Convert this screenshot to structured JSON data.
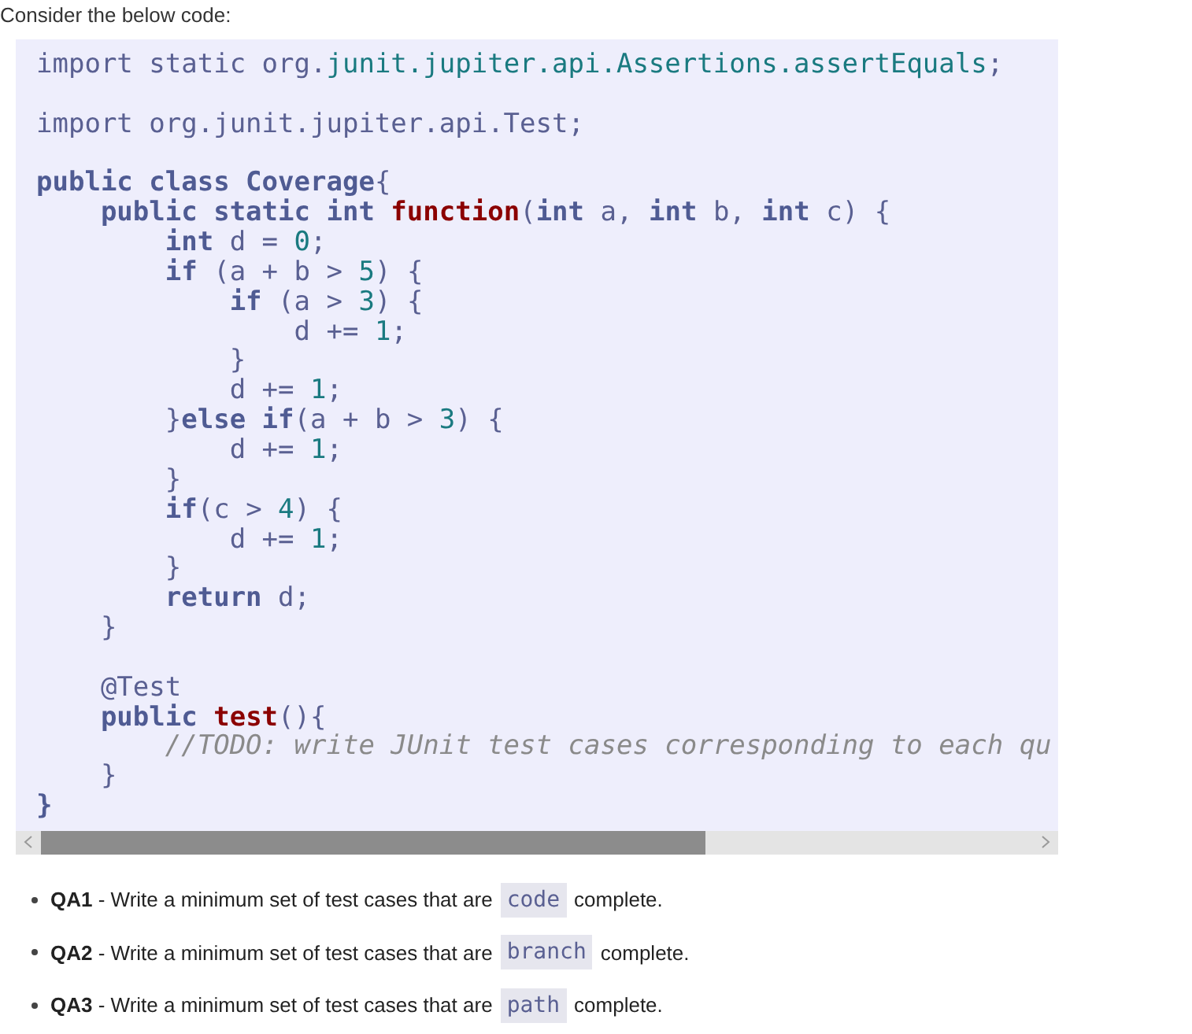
{
  "intro": "Consider the below code:",
  "code_lines": [
    [
      {
        "kind": "plain",
        "text": "import static org."
      },
      {
        "kind": "pkg",
        "text": "junit.jupiter.api.Assertions.assertEquals"
      },
      {
        "kind": "plain",
        "text": ";"
      }
    ],
    [
      {
        "kind": "gap"
      },
      {
        "kind": "plain",
        "text": "import org.junit.jupiter.api.Test;"
      }
    ],
    [
      {
        "kind": "gap"
      },
      {
        "kind": "kw",
        "text": "public class Coverage"
      },
      {
        "kind": "plain",
        "text": "{"
      }
    ],
    [
      {
        "kind": "kw",
        "text": "    public static int "
      },
      {
        "kind": "fn",
        "text": "function"
      },
      {
        "kind": "plain",
        "text": "("
      },
      {
        "kind": "kw",
        "text": "int"
      },
      {
        "kind": "plain",
        "text": " a, "
      },
      {
        "kind": "kw",
        "text": "int"
      },
      {
        "kind": "plain",
        "text": " b, "
      },
      {
        "kind": "kw",
        "text": "int"
      },
      {
        "kind": "plain",
        "text": " c) {"
      }
    ],
    [
      {
        "kind": "kw",
        "text": "        int"
      },
      {
        "kind": "plain",
        "text": " d = "
      },
      {
        "kind": "num",
        "text": "0"
      },
      {
        "kind": "plain",
        "text": ";"
      }
    ],
    [
      {
        "kind": "kw",
        "text": "        if"
      },
      {
        "kind": "plain",
        "text": " (a + b > "
      },
      {
        "kind": "num",
        "text": "5"
      },
      {
        "kind": "plain",
        "text": ") {"
      }
    ],
    [
      {
        "kind": "kw",
        "text": "            if"
      },
      {
        "kind": "plain",
        "text": " (a > "
      },
      {
        "kind": "num",
        "text": "3"
      },
      {
        "kind": "plain",
        "text": ") {"
      }
    ],
    [
      {
        "kind": "plain",
        "text": "                d += "
      },
      {
        "kind": "num",
        "text": "1"
      },
      {
        "kind": "plain",
        "text": ";"
      }
    ],
    [
      {
        "kind": "plain",
        "text": "            }"
      }
    ],
    [
      {
        "kind": "plain",
        "text": "            d += "
      },
      {
        "kind": "num",
        "text": "1"
      },
      {
        "kind": "plain",
        "text": ";"
      }
    ],
    [
      {
        "kind": "plain",
        "text": "        }"
      },
      {
        "kind": "kw",
        "text": "else if"
      },
      {
        "kind": "plain",
        "text": "(a + b > "
      },
      {
        "kind": "num",
        "text": "3"
      },
      {
        "kind": "plain",
        "text": ") {"
      }
    ],
    [
      {
        "kind": "plain",
        "text": "            d += "
      },
      {
        "kind": "num",
        "text": "1"
      },
      {
        "kind": "plain",
        "text": ";"
      }
    ],
    [
      {
        "kind": "plain",
        "text": "        }"
      }
    ],
    [
      {
        "kind": "kw",
        "text": "        if"
      },
      {
        "kind": "plain",
        "text": "(c > "
      },
      {
        "kind": "num",
        "text": "4"
      },
      {
        "kind": "plain",
        "text": ") {"
      }
    ],
    [
      {
        "kind": "plain",
        "text": "            d += "
      },
      {
        "kind": "num",
        "text": "1"
      },
      {
        "kind": "plain",
        "text": ";"
      }
    ],
    [
      {
        "kind": "plain",
        "text": "        }"
      }
    ],
    [
      {
        "kind": "kw",
        "text": "        return"
      },
      {
        "kind": "plain",
        "text": " d;"
      }
    ],
    [
      {
        "kind": "plain",
        "text": "    }"
      }
    ],
    [
      {
        "kind": "gap"
      },
      {
        "kind": "plain",
        "text": "    @Test"
      }
    ],
    [
      {
        "kind": "kw",
        "text": "    public "
      },
      {
        "kind": "fn",
        "text": "test"
      },
      {
        "kind": "plain",
        "text": "(){"
      }
    ],
    [
      {
        "kind": "cm",
        "text": "        //TODO: write JUnit test cases corresponding to each qu"
      }
    ],
    [
      {
        "kind": "plain",
        "text": "    }"
      }
    ],
    [
      {
        "kind": "kw",
        "text": "}"
      }
    ]
  ],
  "questions": [
    {
      "text": "**QA1** - Write a minimum set of test cases that are",
      "term": "code",
      "tail": "complete."
    },
    {
      "text": "**QA2** - Write a minimum set of test cases that are",
      "term": "branch",
      "tail": "complete."
    },
    {
      "text": "**QA3** - Write a minimum set of test cases that are",
      "term": "path",
      "tail": "complete."
    }
  ]
}
